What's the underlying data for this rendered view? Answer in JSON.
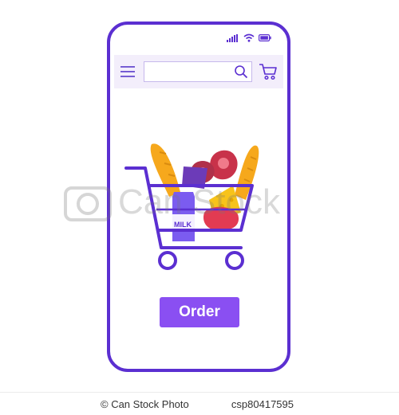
{
  "status_bar": {
    "icons": [
      "signal-icon",
      "wifi-icon",
      "battery-icon"
    ]
  },
  "app_bar": {
    "menu_icon": "hamburger-icon",
    "search": {
      "value": "",
      "placeholder": "",
      "icon": "search-icon"
    },
    "cart_icon": "cart-icon"
  },
  "hero": {
    "description_icon": "grocery-cart-illustration",
    "milk_label": "MILK"
  },
  "order_button": {
    "label": "Order"
  },
  "watermark": {
    "text": "Can Stock"
  },
  "footer": {
    "site": "© Can Stock Photo",
    "code": "csp80417595"
  },
  "colors": {
    "accent": "#5b2fd1",
    "button": "#8a4ff2",
    "appbar": "#f3eefb"
  }
}
